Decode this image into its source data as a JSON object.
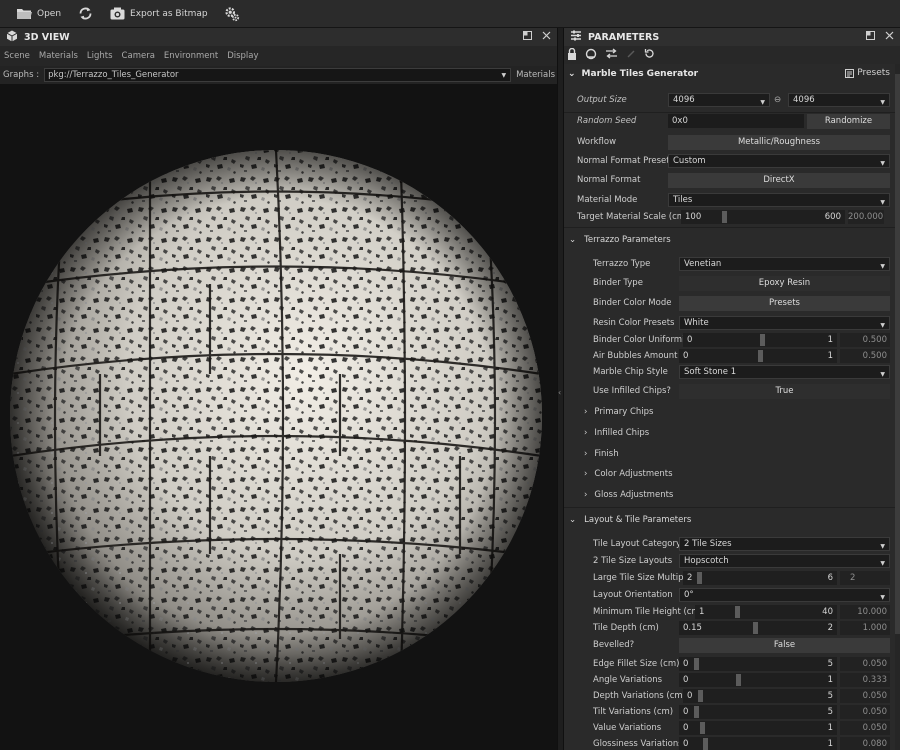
{
  "toolbar": {
    "open_label": "Open",
    "export_label": "Export as Bitmap"
  },
  "view3d": {
    "title": "3D VIEW",
    "menu": [
      "Scene",
      "Materials",
      "Lights",
      "Camera",
      "Environment",
      "Display"
    ],
    "graphs_label": "Graphs :",
    "graph_value": "pkg://Terrazzo_Tiles_Generator",
    "materials_label": "Materials"
  },
  "params": {
    "title": "PARAMETERS",
    "generator_title": "Marble Tiles Generator",
    "presets_label": "Presets",
    "output_size_label": "Output Size",
    "output_size_w": "4096",
    "output_size_h": "4096",
    "random_seed_label": "Random Seed",
    "random_seed_value": "0x0",
    "randomize_label": "Randomize",
    "workflow_label": "Workflow",
    "workflow_value": "Metallic/Roughness",
    "normal_preset_label": "Normal Format Preset",
    "normal_preset_value": "Custom",
    "normal_format_label": "Normal Format",
    "normal_format_value": "DirectX",
    "material_mode_label": "Material Mode",
    "material_mode_value": "Tiles",
    "target_scale_label": "Target Material Scale (cm)",
    "target_scale_min": "100",
    "target_scale_max": "600",
    "target_scale_value": "200.000",
    "target_scale_fraction": 0.2,
    "terrazzo_section": "Terrazzo Parameters",
    "terrazzo_type_label": "Terrazzo Type",
    "terrazzo_type_value": "Venetian",
    "binder_type_label": "Binder Type",
    "binder_type_value": "Epoxy Resin",
    "binder_color_mode_label": "Binder Color Mode",
    "binder_color_mode_value": "Presets",
    "resin_presets_label": "Resin Color Presets",
    "resin_presets_value": "White",
    "binder_uniformity_label": "Binder Color Uniformity",
    "binder_uniformity_min": "0",
    "binder_uniformity_max": "1",
    "binder_uniformity_value": "0.500",
    "binder_uniformity_fraction": 0.5,
    "air_bubbles_label": "Air Bubbles Amount",
    "air_bubbles_min": "0",
    "air_bubbles_max": "1",
    "air_bubbles_value": "0.500",
    "air_bubbles_fraction": 0.5,
    "chip_style_label": "Marble Chip Style",
    "chip_style_value": "Soft Stone 1",
    "infilled_label": "Use Infilled Chips?",
    "infilled_value": "True",
    "groups": [
      "Primary Chips",
      "Infilled Chips",
      "Finish",
      "Color Adjustments",
      "Gloss Adjustments"
    ],
    "layout_section": "Layout & Tile Parameters",
    "layout_category_label": "Tile Layout Category",
    "layout_category_value": "2 Tile Sizes",
    "size_layouts_label": "2 Tile Size Layouts",
    "size_layouts_value": "Hopscotch",
    "large_multiple_label": "Large Tile Size Multiple",
    "large_multiple_min": "2",
    "large_multiple_max": "6",
    "large_multiple_value": "2",
    "large_multiple_fraction": 0.0,
    "orientation_label": "Layout Orientation",
    "orientation_value": "0°",
    "min_height_label": "Minimum Tile Height (cm)",
    "min_height_min": "1",
    "min_height_max": "40",
    "min_height_value": "10.000",
    "min_height_fraction": 0.23,
    "depth_label": "Tile Depth (cm)",
    "depth_min": "0.15",
    "depth_max": "2",
    "depth_value": "1.000",
    "depth_fraction": 0.46,
    "bevelled_label": "Bevelled?",
    "bevelled_value": "False",
    "edge_fillet_label": "Edge Fillet Size (cm)",
    "edge_fillet_min": "0",
    "edge_fillet_max": "5",
    "edge_fillet_value": "0.050",
    "edge_fillet_fraction": 0.01,
    "angle_var_label": "Angle Variations",
    "angle_var_min": "0",
    "angle_var_max": "1",
    "angle_var_value": "0.333",
    "angle_var_fraction": 0.333,
    "depth_var_label": "Depth Variations (cm)",
    "depth_var_min": "0",
    "depth_var_max": "5",
    "depth_var_value": "0.050",
    "depth_var_fraction": 0.01,
    "tilt_var_label": "Tilt Variations (cm)",
    "tilt_var_min": "0",
    "tilt_var_max": "5",
    "tilt_var_value": "0.050",
    "tilt_var_fraction": 0.01,
    "value_var_label": "Value Variations",
    "value_var_min": "0",
    "value_var_max": "1",
    "value_var_value": "0.050",
    "value_var_fraction": 0.05,
    "gloss_var_label": "Glossiness Variations",
    "gloss_var_min": "0",
    "gloss_var_max": "1",
    "gloss_var_value": "0.080",
    "gloss_var_fraction": 0.08
  },
  "colors": {
    "panel_bg": "#2a2a2a",
    "viewport_bg": "#121212",
    "button_bg": "#3a3a3a"
  }
}
